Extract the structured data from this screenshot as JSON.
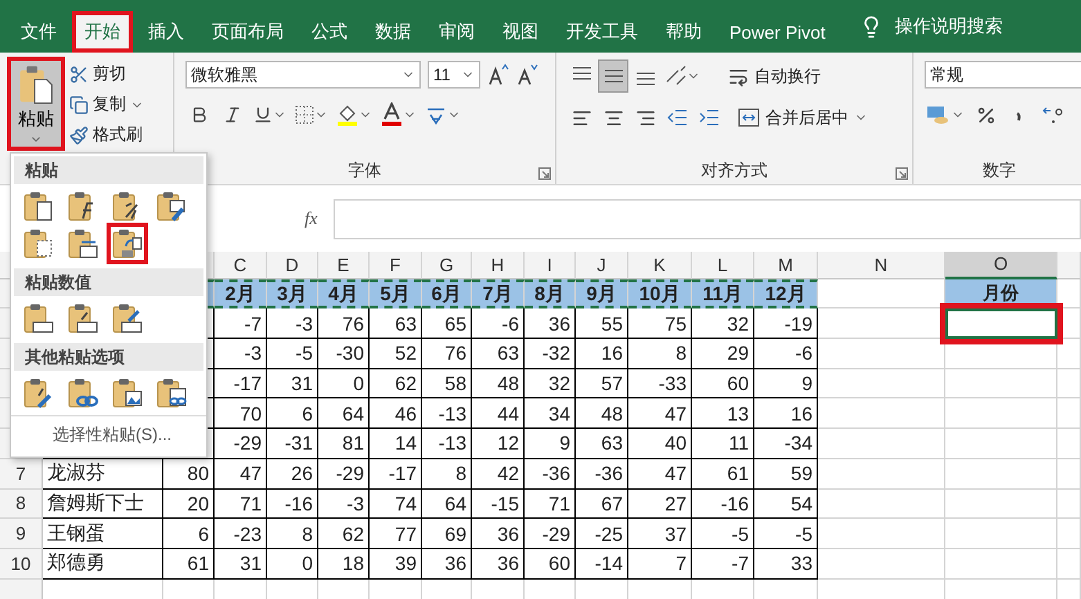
{
  "ribbon_tabs": [
    {
      "label": "文件",
      "selected": false,
      "highlighted": false
    },
    {
      "label": "开始",
      "selected": true,
      "highlighted": true
    },
    {
      "label": "插入",
      "selected": false,
      "highlighted": false
    },
    {
      "label": "页面布局",
      "selected": false,
      "highlighted": false
    },
    {
      "label": "公式",
      "selected": false,
      "highlighted": false
    },
    {
      "label": "数据",
      "selected": false,
      "highlighted": false
    },
    {
      "label": "审阅",
      "selected": false,
      "highlighted": false
    },
    {
      "label": "视图",
      "selected": false,
      "highlighted": false
    },
    {
      "label": "开发工具",
      "selected": false,
      "highlighted": false
    },
    {
      "label": "帮助",
      "selected": false,
      "highlighted": false
    },
    {
      "label": "Power Pivot",
      "selected": false,
      "highlighted": false
    }
  ],
  "tell_me": {
    "label": "操作说明搜索"
  },
  "clipboard": {
    "paste": {
      "label": "粘贴",
      "highlighted": true,
      "pressed": true
    },
    "buttons": [
      {
        "kind": "cut",
        "label": "剪切",
        "dropdown": false
      },
      {
        "kind": "copy",
        "label": "复制",
        "dropdown": true
      },
      {
        "kind": "painter",
        "label": "格式刷",
        "dropdown": false
      }
    ]
  },
  "font": {
    "name": "微软雅黑",
    "size": "11",
    "group_label": "字体"
  },
  "alignment": {
    "vertical_buttons": [
      {
        "kind": "top",
        "selected": false
      },
      {
        "kind": "middle",
        "selected": true
      },
      {
        "kind": "bottom",
        "selected": false
      }
    ],
    "wrap_label": "自动换行",
    "merge_label": "合并后居中",
    "group_label": "对齐方式"
  },
  "number": {
    "format": "常规",
    "group_label": "数字"
  },
  "formula_bar": {
    "fx": "fx"
  },
  "column_headers": [
    {
      "label": "C",
      "selected": false
    },
    {
      "label": "D",
      "selected": false
    },
    {
      "label": "E",
      "selected": false
    },
    {
      "label": "F",
      "selected": false
    },
    {
      "label": "G",
      "selected": false
    },
    {
      "label": "H",
      "selected": false
    },
    {
      "label": "I",
      "selected": false
    },
    {
      "label": "J",
      "selected": false
    },
    {
      "label": "K",
      "selected": false
    },
    {
      "label": "L",
      "selected": false
    },
    {
      "label": "M",
      "selected": false
    },
    {
      "label": "N",
      "selected": false
    },
    {
      "label": "O",
      "selected": true
    }
  ],
  "rows": [
    {
      "kind": "header",
      "cells": [
        null,
        "2月",
        "3月",
        "4月",
        "5月",
        "6月",
        "7月",
        "8月",
        "9月",
        "10月",
        "11月",
        "12月"
      ],
      "o_cell": "月份",
      "o_selected": false,
      "o_highlighted": false
    },
    {
      "kind": "data",
      "cells": [
        null,
        "-7",
        "-3",
        "76",
        "63",
        "65",
        "-6",
        "36",
        "55",
        "75",
        "32",
        "-19"
      ],
      "o_selected": true,
      "o_highlighted": true
    },
    {
      "kind": "data",
      "cells": [
        null,
        "-3",
        "-5",
        "-30",
        "52",
        "76",
        "63",
        "-32",
        "16",
        "8",
        "29",
        "-6"
      ],
      "o_selected": false,
      "o_highlighted": false
    },
    {
      "kind": "data",
      "cells": [
        null,
        "-17",
        "31",
        "0",
        "62",
        "58",
        "48",
        "32",
        "57",
        "-33",
        "60",
        "9"
      ],
      "o_selected": false,
      "o_highlighted": false
    },
    {
      "kind": "data",
      "cells": [
        null,
        "70",
        "6",
        "64",
        "46",
        "-13",
        "44",
        "34",
        "48",
        "47",
        "13",
        "16"
      ],
      "o_selected": false,
      "o_highlighted": false
    },
    {
      "kind": "data",
      "cells": [
        null,
        "-29",
        "-31",
        "81",
        "14",
        "-13",
        "12",
        "9",
        "63",
        "40",
        "11",
        "-34"
      ],
      "o_selected": false,
      "o_highlighted": false
    },
    {
      "kind": "data",
      "number": "7",
      "name": "龙淑芬",
      "cells": [
        "80",
        "47",
        "26",
        "-29",
        "-17",
        "8",
        "42",
        "-36",
        "-36",
        "47",
        "61",
        "59"
      ],
      "o_selected": false,
      "o_highlighted": false
    },
    {
      "kind": "data",
      "number": "8",
      "name": "詹姆斯下士",
      "cells": [
        "20",
        "71",
        "-16",
        "-3",
        "74",
        "64",
        "-15",
        "71",
        "67",
        "27",
        "-16",
        "54"
      ],
      "o_selected": false,
      "o_highlighted": false
    },
    {
      "kind": "data",
      "number": "9",
      "name": "王钢蛋",
      "cells": [
        "6",
        "-23",
        "8",
        "62",
        "77",
        "69",
        "36",
        "-29",
        "-25",
        "37",
        "-5",
        "-5"
      ],
      "o_selected": false,
      "o_highlighted": false
    },
    {
      "kind": "data",
      "number": "10",
      "name": "郑德勇",
      "cells": [
        "61",
        "31",
        "0",
        "18",
        "39",
        "36",
        "36",
        "60",
        "-14",
        "7",
        "-7",
        "33"
      ],
      "o_selected": false,
      "o_highlighted": false
    },
    {
      "kind": "empty",
      "o_selected": false,
      "o_highlighted": false
    }
  ],
  "paste_menu": {
    "sections": [
      {
        "title": "粘贴",
        "items": [
          {
            "kind": "paste",
            "highlighted": false
          },
          {
            "kind": "formulas",
            "highlighted": false
          },
          {
            "kind": "formulas_format",
            "highlighted": false
          },
          {
            "kind": "keep_format",
            "highlighted": false
          },
          {
            "kind": "no_borders",
            "highlighted": false
          },
          {
            "kind": "col_widths",
            "highlighted": false
          },
          {
            "kind": "transpose",
            "highlighted": true
          }
        ]
      },
      {
        "title": "粘贴数值",
        "items": [
          {
            "kind": "values",
            "highlighted": false
          },
          {
            "kind": "values_format",
            "highlighted": false
          },
          {
            "kind": "values_source",
            "highlighted": false
          }
        ]
      },
      {
        "title": "其他粘贴选项",
        "items": [
          {
            "kind": "formatting",
            "highlighted": false
          },
          {
            "kind": "link",
            "highlighted": false
          },
          {
            "kind": "picture",
            "highlighted": false
          },
          {
            "kind": "linked_picture",
            "highlighted": false
          }
        ]
      }
    ],
    "footer": "选择性粘贴(S)..."
  }
}
